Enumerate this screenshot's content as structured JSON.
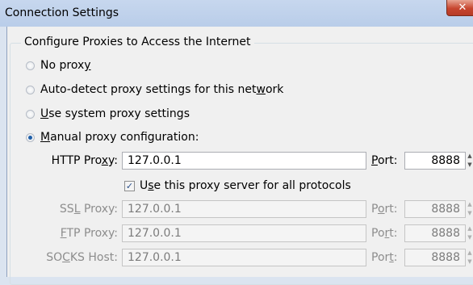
{
  "window": {
    "title": "Connection Settings",
    "close_glyph": "✕"
  },
  "group": {
    "legend": "Configure Proxies to Access the Internet"
  },
  "radios": [
    {
      "pre": "No prox",
      "accel": "y",
      "post": "",
      "checked": false
    },
    {
      "pre": "Auto-detect proxy settings for this net",
      "accel": "w",
      "post": "ork",
      "checked": false
    },
    {
      "pre": "",
      "accel": "U",
      "post": "se system proxy settings",
      "checked": false
    },
    {
      "pre": "",
      "accel": "M",
      "post": "anual proxy configuration:",
      "checked": true
    }
  ],
  "http": {
    "label_pre": "HTTP Pro",
    "label_accel": "x",
    "label_post": "y:",
    "value": "127.0.0.1",
    "port_pre": "",
    "port_accel": "P",
    "port_post": "ort:",
    "port_value": "8888"
  },
  "share": {
    "checked": true,
    "check_glyph": "✓",
    "pre": "U",
    "accel": "s",
    "post": "e this proxy server for all protocols"
  },
  "ssl": {
    "label_pre": "SS",
    "label_accel": "L",
    "label_post": " Proxy:",
    "value": "127.0.0.1",
    "port_pre": "P",
    "port_accel": "o",
    "port_post": "rt:",
    "port_value": "8888"
  },
  "ftp": {
    "label_pre": "",
    "label_accel": "F",
    "label_post": "TP Proxy:",
    "value": "127.0.0.1",
    "port_pre": "Po",
    "port_accel": "r",
    "port_post": "t:",
    "port_value": "8888"
  },
  "socks": {
    "label_pre": "SO",
    "label_accel": "C",
    "label_post": "KS Host:",
    "value": "127.0.0.1",
    "port_pre": "Por",
    "port_accel": "t",
    "port_post": ":",
    "port_value": "8888"
  },
  "spinner": {
    "up": "▲",
    "down": "▼"
  },
  "colors": {
    "accent": "#1f5fa8",
    "disabled_text": "#8d8d8d"
  }
}
